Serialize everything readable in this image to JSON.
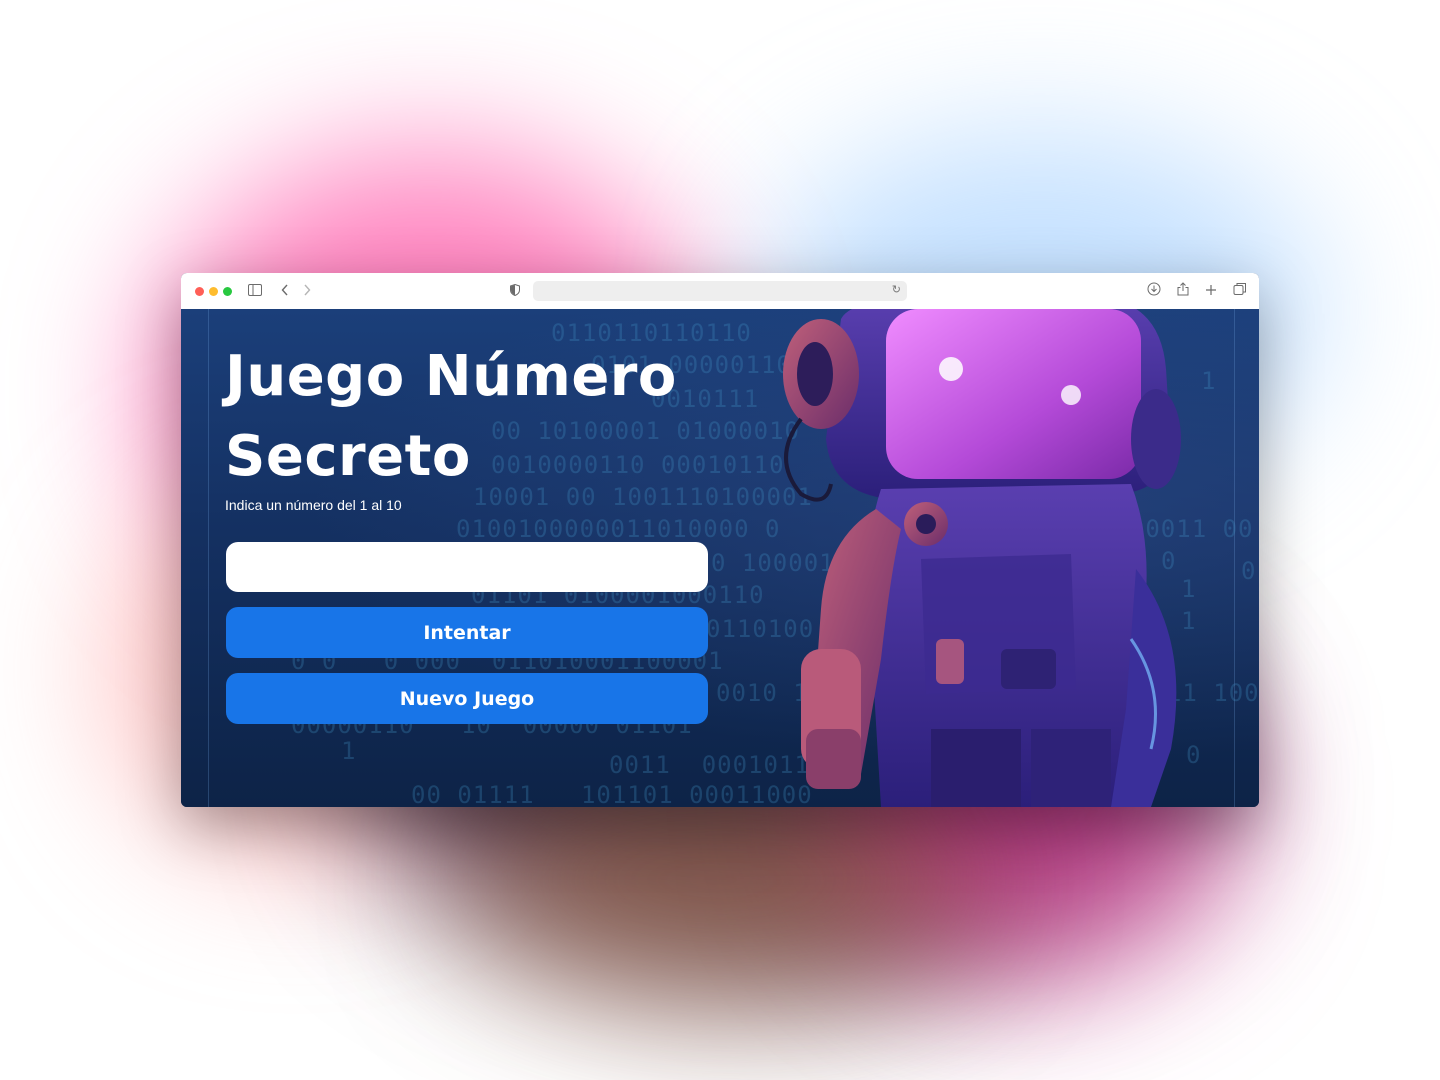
{
  "page": {
    "title": "Juego Número Secreto",
    "subtitle": "Indica un número del 1 al 10"
  },
  "form": {
    "input_value": "",
    "try_label": "Intentar",
    "new_game_label": "Nuevo Juego"
  },
  "browser": {
    "icons": [
      "sidebar-icon",
      "back-icon",
      "forward-icon",
      "privacy-shield-icon",
      "reload-icon",
      "download-icon",
      "share-icon",
      "new-tab-icon",
      "tabs-overview-icon"
    ]
  },
  "colors": {
    "button": "#1875e8",
    "background": "#143061",
    "title": "#ffffff"
  }
}
